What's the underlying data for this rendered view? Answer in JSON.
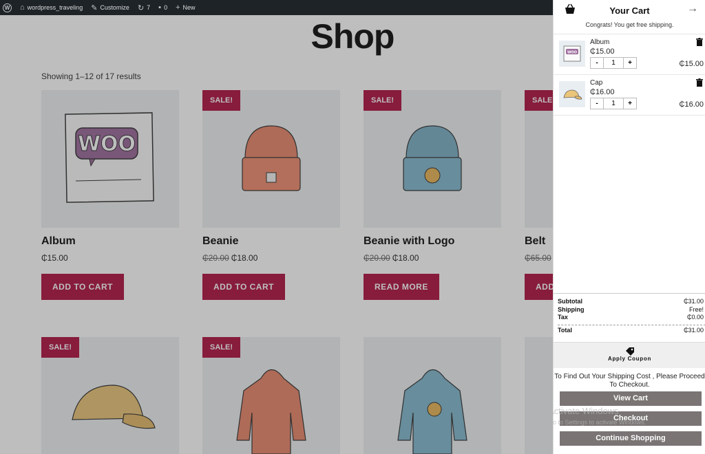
{
  "adminbar": {
    "site_name": "wordpress_traveling",
    "customize": "Customize",
    "updates_count": "7",
    "comments_count": "0",
    "new_label": "New"
  },
  "shop": {
    "title": "Shop",
    "results_text": "Showing 1–12 of 17 results",
    "sale_badge": "SALE!",
    "products": [
      {
        "name": "Album",
        "price": "₵15.00",
        "old_price": "",
        "button": "ADD TO CART",
        "sale": false
      },
      {
        "name": "Beanie",
        "price": "₵18.00",
        "old_price": "₵20.00",
        "button": "ADD TO CART",
        "sale": true
      },
      {
        "name": "Beanie with Logo",
        "price": "₵18.00",
        "old_price": "₵20.00",
        "button": "READ MORE",
        "sale": true
      },
      {
        "name": "Belt",
        "price": "",
        "old_price": "₵65.00",
        "button": "ADD",
        "sale": true
      }
    ],
    "row2_sale": [
      "SALE!",
      "SALE!"
    ]
  },
  "cart": {
    "title": "Your Cart",
    "congrats": "Congrats! You get free shipping.",
    "items": [
      {
        "name": "Album",
        "price": "₵15.00",
        "qty": "1",
        "total": "₵15.00",
        "thumb_label": "WOO"
      },
      {
        "name": "Cap",
        "price": "₵16.00",
        "qty": "1",
        "total": "₵16.00"
      }
    ],
    "totals": {
      "subtotal_label": "Subtotal",
      "subtotal": "₵31.00",
      "shipping_label": "Shipping",
      "shipping": "Free!",
      "tax_label": "Tax",
      "tax": "₵0.00",
      "total_label": "Total",
      "total": "₵31.00"
    },
    "coupon_label": "Apply Coupon",
    "ship_message": "To Find Out Your Shipping Cost , Please Proceed To Checkout.",
    "view_cart": "View Cart",
    "checkout": "Checkout",
    "continue": "Continue Shopping"
  },
  "watermark": {
    "line1": "Activate Windows",
    "line2": "Go to Settings to activate Windows."
  },
  "colors": {
    "accent": "#b01845",
    "admin_bar": "#1d2327",
    "cart_button": "#7a7474"
  }
}
